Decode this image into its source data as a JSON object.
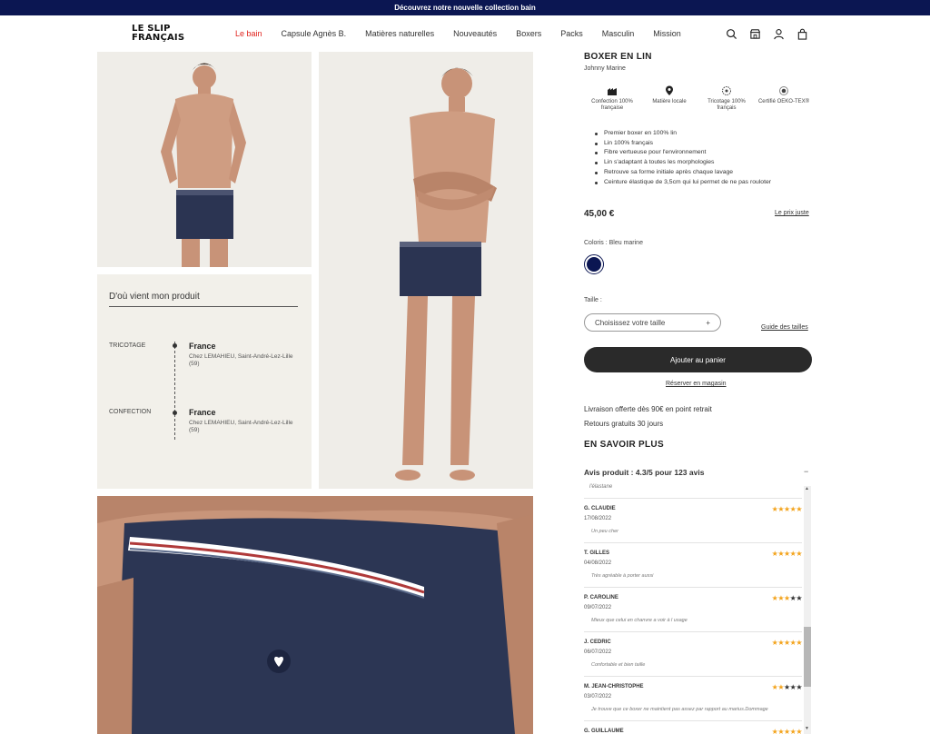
{
  "promo": {
    "text": "Découvrez notre nouvelle collection bain"
  },
  "logo": {
    "line1": "LE SLIP",
    "line2": "FRANÇAIS"
  },
  "nav": [
    {
      "label": "Le bain",
      "active": true
    },
    {
      "label": "Capsule Agnès B."
    },
    {
      "label": "Matières naturelles"
    },
    {
      "label": "Nouveautés"
    },
    {
      "label": "Boxers"
    },
    {
      "label": "Packs"
    },
    {
      "label": "Masculin"
    },
    {
      "label": "Mission"
    }
  ],
  "header_icons": [
    "search-icon",
    "store-icon",
    "account-icon",
    "cart-icon"
  ],
  "origin": {
    "title": "D'où vient mon produit",
    "steps": [
      {
        "label": "TRICOTAGE",
        "country": "France",
        "address": "Chez LEMAHIEU, Saint-André-Lez-Lille (59)"
      },
      {
        "label": "CONFECTION",
        "country": "France",
        "address": "Chez LEMAHIEU, Saint-André-Lez-Lille (59)"
      }
    ]
  },
  "product": {
    "title": "BOXER EN LIN",
    "subtitle": "Johnny Marine",
    "features": [
      {
        "icon": "factory-icon",
        "label": "Confection 100% française"
      },
      {
        "icon": "location-pin-icon",
        "label": "Matière locale"
      },
      {
        "icon": "knitting-icon",
        "label": "Tricotage 100% français"
      },
      {
        "icon": "certified-icon",
        "label": "Certifié OEKO-TEX®"
      }
    ],
    "bullets": [
      "Premier boxer en 100% lin",
      "Lin 100% français",
      "Fibre vertueuse pour l'environnement",
      "Lin s'adaptant à toutes les morphologies",
      "Retrouve sa forme initiale après chaque lavage",
      "Ceinture élastique de 3,5cm qui lui permet de ne pas rouloter"
    ],
    "price": "45,00 €",
    "price_link": "Le prix juste",
    "color_label": "Coloris : Bleu marine",
    "color_hex": "#0b1652",
    "size_label": "Taille :",
    "size_placeholder": "Choisissez votre taille",
    "size_plus": "+",
    "size_guide": "Guide des tailles",
    "add_to_cart": "Ajouter au panier",
    "reserve": "Réserver en magasin",
    "shipping": "Livraison offerte dès 90€ en point retrait",
    "returns": "Retours gratuits 30 jours",
    "learn_more": "EN SAVOIR PLUS",
    "reviews_heading": "Avis produit : 4.3/5 pour 123 avis",
    "reviews_toggle": "−"
  },
  "reviews": {
    "truncated_text": "l'élastane",
    "items": [
      {
        "name": "G. CLAUDIE",
        "date": "17/08/2022",
        "text": "Un peu cher",
        "rating": 5
      },
      {
        "name": "T. GILLES",
        "date": "04/08/2022",
        "text": "Très agréable à porter aussi",
        "rating": 5
      },
      {
        "name": "P. CAROLINE",
        "date": "09/07/2022",
        "text": "Mieux que celui en chanvre a voir à l usage",
        "rating": 3
      },
      {
        "name": "J. CEDRIC",
        "date": "06/07/2022",
        "text": "Confortable et bien taille",
        "rating": 5
      },
      {
        "name": "M. JEAN-CHRISTOPHE",
        "date": "03/07/2022",
        "text": "Je trouve que ce boxer ne maintient pas assez par rapport au marius.Dommage",
        "rating": 2
      },
      {
        "name": "G. GUILLAUME",
        "date": "",
        "text": "",
        "rating": 5
      }
    ]
  },
  "colors": {
    "navy": "#0b1652",
    "accent_red": "#e0231d",
    "star": "#f3a31b"
  }
}
